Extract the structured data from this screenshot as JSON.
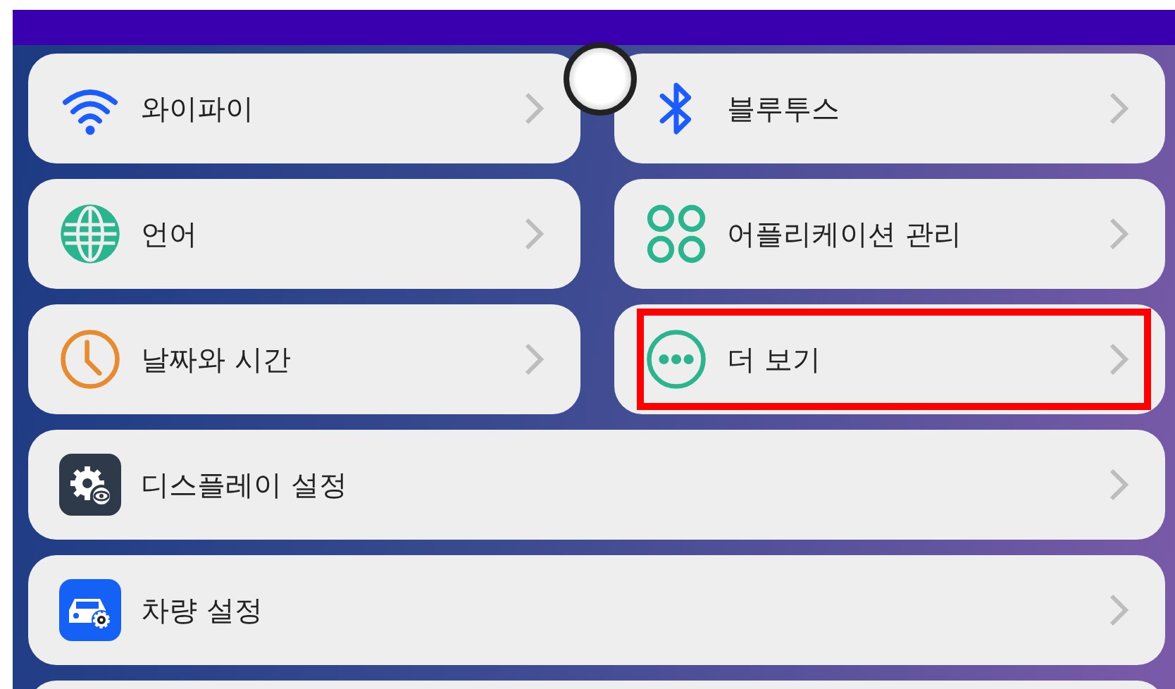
{
  "grid_items": [
    {
      "label": "와이파이",
      "highlighted": false
    },
    {
      "label": "블루투스",
      "highlighted": false
    },
    {
      "label": "언어",
      "highlighted": false
    },
    {
      "label": "어플리케이션 관리",
      "highlighted": false
    },
    {
      "label": "날짜와 시간",
      "highlighted": false
    },
    {
      "label": "더 보기",
      "highlighted": true
    }
  ],
  "list_items": [
    {
      "label": "디스플레이 설정",
      "highlighted": false
    },
    {
      "label": "차량 설정",
      "highlighted": false
    }
  ]
}
